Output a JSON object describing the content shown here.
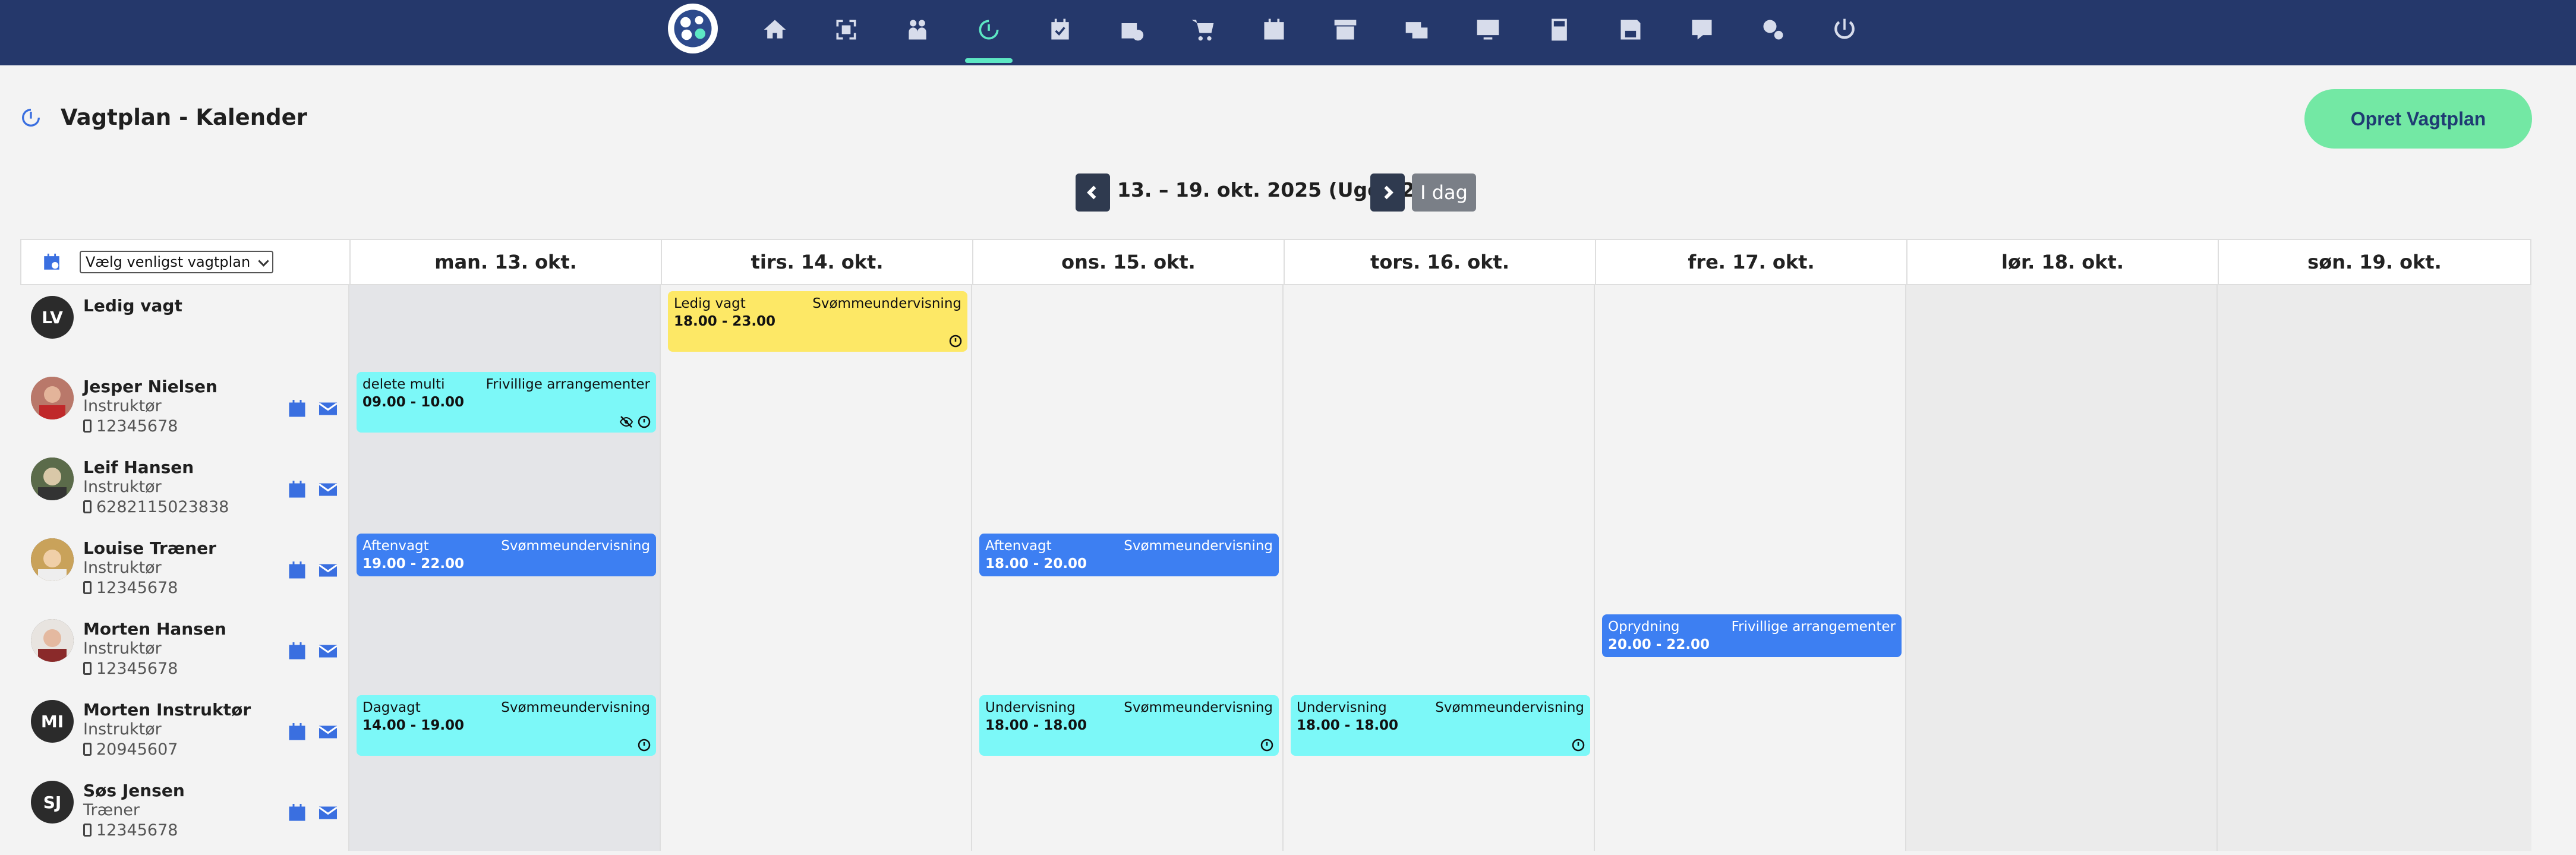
{
  "app": {
    "title": "Vagtplan - Kalender",
    "create_button": "Opret Vagtplan"
  },
  "nav": {
    "icons": [
      "logo-icon",
      "home-icon",
      "scan-icon",
      "people-icon",
      "timer-icon",
      "calendar-check-icon",
      "box-check-icon",
      "cart-icon",
      "calendar-icon",
      "archive-icon",
      "mail-card-icon",
      "monitor-icon",
      "calculator-icon",
      "floppy-icon",
      "help-icon",
      "settings-icon",
      "power-icon"
    ],
    "active": "timer-icon"
  },
  "week": {
    "label": "13. – 19. okt. 2025 (Uge 42)",
    "today_button": "I dag"
  },
  "filter": {
    "selected": "Vælg venligst vagtplan"
  },
  "days": [
    "man. 13. okt.",
    "tirs. 14. okt.",
    "ons. 15. okt.",
    "tors. 16. okt.",
    "fre. 17. okt.",
    "lør. 18. okt.",
    "søn. 19. okt."
  ],
  "people": [
    {
      "initials": "LV",
      "name": "Ledig vagt",
      "role": "",
      "phone": ""
    },
    {
      "initials": "",
      "name": "Jesper Nielsen",
      "role": "Instruktør",
      "phone": "12345678"
    },
    {
      "initials": "",
      "name": "Leif Hansen",
      "role": "Instruktør",
      "phone": "6282115023838"
    },
    {
      "initials": "",
      "name": "Louise Træner",
      "role": "Instruktør",
      "phone": "12345678"
    },
    {
      "initials": "",
      "name": "Morten Hansen",
      "role": "Instruktør",
      "phone": "12345678"
    },
    {
      "initials": "MI",
      "name": "Morten Instruktør",
      "role": "Instruktør",
      "phone": "20945607"
    },
    {
      "initials": "SJ",
      "name": "Søs Jensen",
      "role": "Træner",
      "phone": "12345678"
    }
  ],
  "shifts": [
    {
      "title": "Ledig vagt",
      "category": "Svømmeundervisning",
      "time": "18.00 - 23.00"
    },
    {
      "title": "delete multi",
      "category": "Frivillige arrangementer",
      "time": "09.00 - 10.00"
    },
    {
      "title": "Aftenvagt",
      "category": "Svømmeundervisning",
      "time": "19.00 - 22.00"
    },
    {
      "title": "Aftenvagt",
      "category": "Svømmeundervisning",
      "time": "18.00 - 20.00"
    },
    {
      "title": "Oprydning",
      "category": "Frivillige arrangementer",
      "time": "20.00 - 22.00"
    },
    {
      "title": "Dagvagt",
      "category": "Svømmeundervisning",
      "time": "14.00 - 19.00"
    },
    {
      "title": "Undervisning",
      "category": "Svømmeundervisning",
      "time": "18.00 - 18.00"
    },
    {
      "title": "Undervisning",
      "category": "Svømmeundervisning",
      "time": "18.00 - 18.00"
    }
  ],
  "colors": {
    "nav_bg": "#25386b",
    "accent_green": "#73e8a4",
    "shift_yellow": "#fde866",
    "shift_cyan": "#7cf8f8",
    "shift_blue": "#3d7ff2",
    "icon_blue": "#3a6fe0"
  }
}
